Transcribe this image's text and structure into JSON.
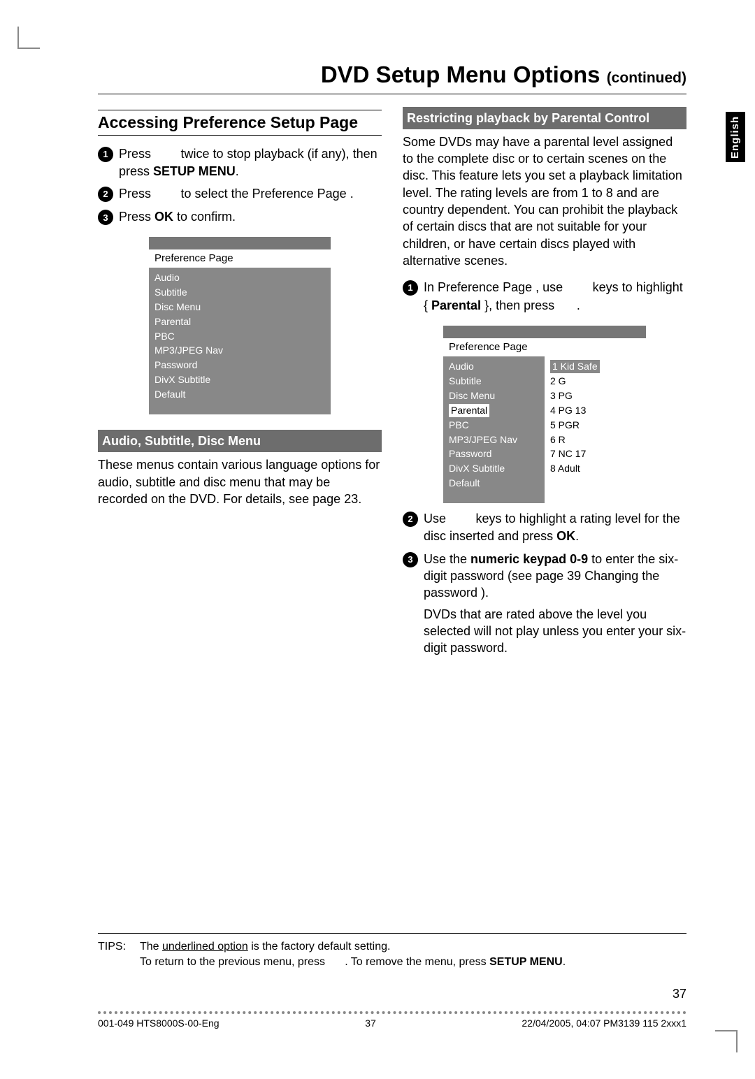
{
  "header": {
    "title": "DVD Setup Menu Options",
    "suffix": "(continued)"
  },
  "language_tab": "English",
  "left": {
    "section_title": "Accessing Preference Setup Page",
    "steps": [
      {
        "n": "1",
        "pre": "Press ",
        "mid": "",
        "post": " twice to stop playback (if any), then press ",
        "bold": "SETUP MENU",
        "tail": "."
      },
      {
        "n": "2",
        "pre": "Press ",
        "mid": "",
        "post": " to select the Preference Page ."
      },
      {
        "n": "3",
        "pre": "Press ",
        "bold": "OK",
        "tail": " to confirm."
      }
    ],
    "menu": {
      "title": "Preference Page",
      "items": [
        "Audio",
        "Subtitle",
        "Disc Menu",
        "Parental",
        "PBC",
        "MP3/JPEG Nav",
        "Password",
        "DivX Subtitle",
        "Default"
      ]
    },
    "sub_band": "Audio, Subtitle, Disc Menu",
    "para": "These menus contain various language options for audio, subtitle and disc menu that may be recorded on the DVD.  For details, see page 23."
  },
  "right": {
    "sub_band": "Restricting playback by Parental Control",
    "intro": "Some DVDs may have a parental level assigned to the complete disc or to certain scenes on the disc.  This feature lets you set a playback limitation level. The rating levels are from 1 to 8 and are country dependent.  You can prohibit the playback of certain discs that are not suitable for your children, or have certain discs played with alternative scenes.",
    "step1_a": "In  Preference Page , use ",
    "step1_b": " keys to highlight { ",
    "step1_bold": "Parental",
    "step1_c": " }, then press ",
    "step1_d": ".",
    "menu": {
      "title": "Preference Page",
      "left_items": [
        "Audio",
        "Subtitle",
        "Disc Menu",
        "Parental",
        "PBC",
        "MP3/JPEG Nav",
        "Password",
        "DivX Subtitle",
        "Default"
      ],
      "highlight_left": "Parental",
      "right_items": [
        "1  Kid Safe",
        "2  G",
        "3  PG",
        "4  PG 13",
        "5  PGR",
        "6  R",
        "7  NC 17",
        "8  Adult"
      ],
      "highlight_right": "1  Kid Safe"
    },
    "step2_a": "Use ",
    "step2_b": " keys to highlight a rating level for the disc inserted and press ",
    "step2_bold": "OK",
    "step2_c": ".",
    "step3_a": "Use the ",
    "step3_bold": "numeric keypad 0-9",
    "step3_b": " to enter the six-digit password (see page 39  Changing the password  ).",
    "step3_note": "    DVDs that are rated above the level you selected will not play unless you enter your six-digit password."
  },
  "tips": {
    "label": "TIPS:",
    "line1_a": "The ",
    "line1_u": "underlined option",
    "line1_b": " is the factory default setting.",
    "line2_a": "To return to the previous menu, press ",
    "line2_b": ".  To remove the menu, press ",
    "line2_bold": "SETUP MENU",
    "line2_c": "."
  },
  "page_number": "37",
  "footer": {
    "left": "001-049 HTS8000S-00-Eng",
    "mid": "37",
    "right": "22/04/2005, 04:07 PM3139 115 2xxx1"
  }
}
